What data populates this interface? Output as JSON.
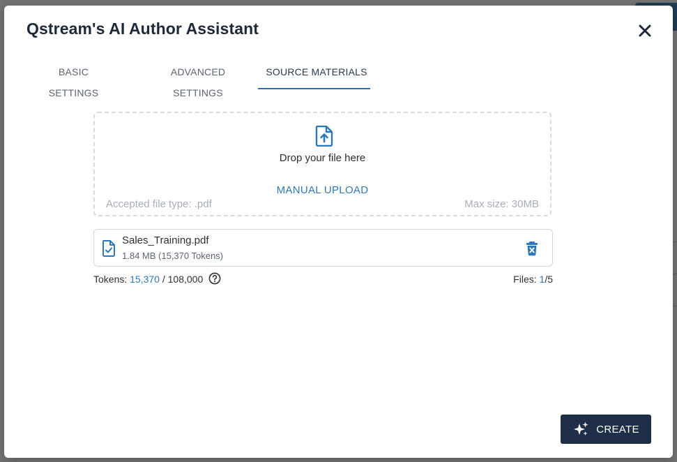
{
  "modal": {
    "title": "Qstream's AI Author Assistant",
    "close_icon": "close-icon"
  },
  "tabs": [
    {
      "label": "BASIC SETTINGS",
      "active": false
    },
    {
      "label": "ADVANCED SETTINGS",
      "active": false
    },
    {
      "label": "SOURCE MATERIALS",
      "active": true
    }
  ],
  "dropzone": {
    "icon": "file-upload-icon",
    "prompt": "Drop your file here",
    "manual_upload_label": "MANUAL UPLOAD",
    "accepted_types": "Accepted file type: .pdf",
    "max_size": "Max size: 30MB"
  },
  "files": [
    {
      "icon": "file-check-icon",
      "name": "Sales_Training.pdf",
      "meta": "1.84 MB (15,370 Tokens)",
      "delete_icon": "delete-icon"
    }
  ],
  "tokens": {
    "label": "Tokens:",
    "used": "15,370",
    "limit": "/ 108,000",
    "help_icon": "help-icon"
  },
  "file_count": {
    "label": "Files:",
    "count": "1",
    "max": "/5"
  },
  "create_button": {
    "label": "CREATE",
    "icon": "sparkle-icon"
  },
  "colors": {
    "accent": "#2f78b7",
    "primary_button": "#1f2f48",
    "title": "#1d2939"
  }
}
